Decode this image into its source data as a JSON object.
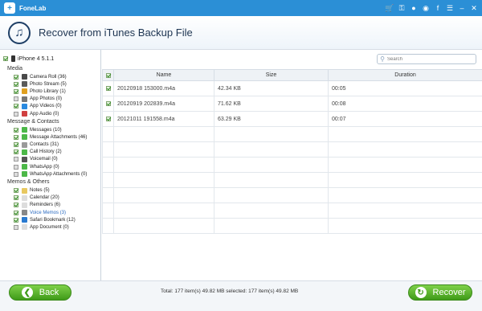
{
  "app": {
    "name": "FoneLab"
  },
  "title_icons": [
    "cart-icon",
    "key-icon",
    "user-icon",
    "chat-icon",
    "facebook-icon",
    "menu-icon",
    "minimize-icon",
    "close-icon"
  ],
  "header": {
    "title": "Recover from iTunes Backup File"
  },
  "device": {
    "label": "iPhone 4 5.1.1"
  },
  "sidebar": {
    "sections": [
      {
        "title": "Media",
        "items": [
          {
            "label": "Camera Roll (36)",
            "checked": true,
            "icon_color": "#4a4a4a"
          },
          {
            "label": "Photo Stream (5)",
            "checked": true,
            "icon_color": "#5a5a5a"
          },
          {
            "label": "Photo Library (1)",
            "checked": true,
            "icon_color": "#e0a020"
          },
          {
            "label": "App Photos (0)",
            "checked": false,
            "icon_color": "#777777"
          },
          {
            "label": "App Videos (0)",
            "checked": true,
            "icon_color": "#2a8ae0"
          },
          {
            "label": "App Audio (0)",
            "checked": false,
            "icon_color": "#d04040"
          }
        ]
      },
      {
        "title": "Message & Contacts",
        "items": [
          {
            "label": "Messages (10)",
            "checked": true,
            "icon_color": "#4cb848"
          },
          {
            "label": "Message Attachments (46)",
            "checked": true,
            "icon_color": "#4cb848"
          },
          {
            "label": "Contacts (31)",
            "checked": true,
            "icon_color": "#9a9a9a"
          },
          {
            "label": "Call History (2)",
            "checked": true,
            "icon_color": "#4cb848"
          },
          {
            "label": "Voicemail (0)",
            "checked": false,
            "icon_color": "#555555"
          },
          {
            "label": "WhatsApp (0)",
            "checked": false,
            "icon_color": "#4cb848"
          },
          {
            "label": "WhatsApp Attachments (0)",
            "checked": false,
            "icon_color": "#4cb848"
          }
        ]
      },
      {
        "title": "Memos & Others",
        "items": [
          {
            "label": "Notes (5)",
            "checked": true,
            "icon_color": "#e8c860"
          },
          {
            "label": "Calendar (20)",
            "checked": true,
            "icon_color": "#dddddd"
          },
          {
            "label": "Reminders (6)",
            "checked": true,
            "icon_color": "#dddddd"
          },
          {
            "label": "Voice Memos (3)",
            "checked": true,
            "icon_color": "#888888",
            "link": true
          },
          {
            "label": "Safari Bookmark (12)",
            "checked": true,
            "icon_color": "#2a7ad0"
          },
          {
            "label": "App Document (0)",
            "checked": false,
            "icon_color": "#dddddd"
          }
        ]
      }
    ]
  },
  "search": {
    "placeholder": "Search"
  },
  "table": {
    "columns": [
      "Name",
      "Size",
      "Duration"
    ],
    "rows": [
      {
        "name": "20120918 153000.m4a",
        "size": "42.34 KB",
        "duration": "00:05"
      },
      {
        "name": "20120919 202839.m4a",
        "size": "71.62 KB",
        "duration": "00:08"
      },
      {
        "name": "20121011 191558.m4a",
        "size": "63.29 KB",
        "duration": "00:07"
      }
    ],
    "empty_rows": 7
  },
  "footer": {
    "back_label": "Back",
    "recover_label": "Recover",
    "totals": "Total: 177 item(s) 49.82 MB   selected: 177 item(s) 49.82 MB"
  },
  "colors": {
    "title_bar": "#2b8fd6",
    "button_green": "#4ea81f",
    "link_blue": "#2a6ac0"
  }
}
